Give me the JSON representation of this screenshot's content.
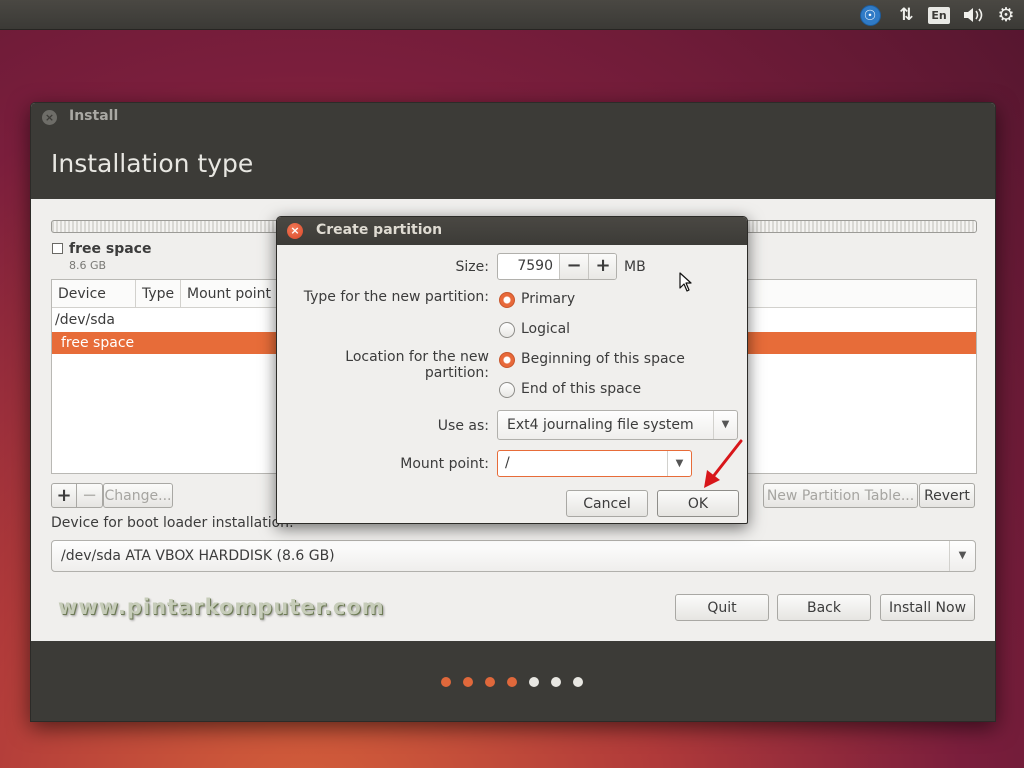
{
  "top_panel": {
    "language": "En",
    "icons": [
      "accessibility-icon",
      "network-icon",
      "keyboard-language-indicator",
      "volume-icon",
      "settings-gear-icon"
    ]
  },
  "installer": {
    "window_title": "Install",
    "page_title": "Installation type",
    "free_space_legend": {
      "name": "free space",
      "size": "8.6 GB"
    },
    "table": {
      "columns": [
        "Device",
        "Type",
        "Mount point"
      ],
      "rows": [
        "/dev/sda",
        "free space"
      ]
    },
    "buttons": {
      "add": "+",
      "remove": "−",
      "change": "Change...",
      "new_partition_table": "New Partition Table...",
      "revert": "Revert",
      "quit": "Quit",
      "back": "Back",
      "install_now": "Install Now"
    },
    "boot_loader_label": "Device for boot loader installation:",
    "boot_loader_value": "/dev/sda  ATA VBOX HARDDISK (8.6 GB)",
    "watermark": "www.pintarkomputer.com",
    "steps": {
      "total": 7,
      "completed": 4
    },
    "colors": {
      "accent": "#e76c39",
      "header": "#3c3b37"
    }
  },
  "dialog": {
    "title": "Create partition",
    "size_label": "Size:",
    "size_value": "7590",
    "size_unit": "MB",
    "spin_minus": "−",
    "spin_plus": "+",
    "type_label": "Type for the new partition:",
    "type_options": [
      "Primary",
      "Logical"
    ],
    "type_selected": "Primary",
    "location_label": "Location for the new partition:",
    "location_options": [
      "Beginning of this space",
      "End of this space"
    ],
    "location_selected": "Beginning of this space",
    "use_as_label": "Use as:",
    "use_as_value": "Ext4 journaling file system",
    "mount_label": "Mount point:",
    "mount_value": "/",
    "cancel": "Cancel",
    "ok": "OK"
  }
}
